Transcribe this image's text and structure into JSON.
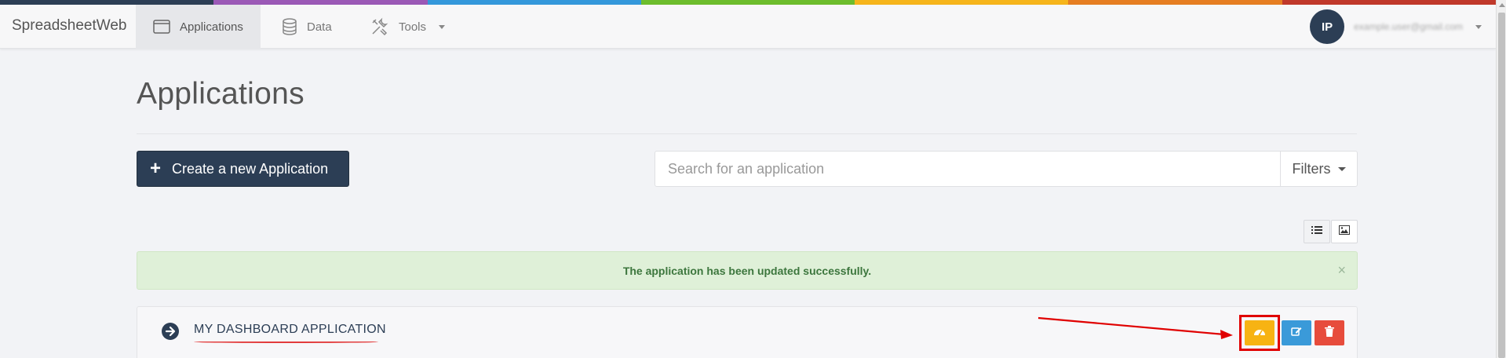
{
  "colors": {
    "strip": [
      "#2c3e55",
      "#9b59b6",
      "#3498db",
      "#6dbd2d",
      "#f6b51b",
      "#e67e22",
      "#c0392b"
    ],
    "primary": "#2c3e55",
    "dashboard_button": "#f7b313",
    "edit_button": "#3a9ad9",
    "delete_button": "#e74c3c",
    "alert_bg": "#dff0d8",
    "annotation": "#e00000"
  },
  "navbar": {
    "brand": "SpreadsheetWeb",
    "items": [
      {
        "label": "Applications",
        "icon": "window-icon",
        "active": true
      },
      {
        "label": "Data",
        "icon": "database-icon",
        "active": false
      },
      {
        "label": "Tools",
        "icon": "tools-icon",
        "active": false,
        "dropdown": true
      }
    ],
    "user": {
      "initials": "IP",
      "email": "example.user@gmail.com"
    }
  },
  "page": {
    "title": "Applications",
    "create_button": "Create a new Application",
    "search": {
      "placeholder": "Search for an application",
      "value": ""
    },
    "filters_label": "Filters",
    "view_modes": [
      {
        "name": "list",
        "icon": "list-icon",
        "active": true
      },
      {
        "name": "grid",
        "icon": "image-icon",
        "active": false
      }
    ],
    "alert": {
      "message": "The application has been updated successfully.",
      "close": "×"
    },
    "applications": [
      {
        "name": "MY DASHBOARD APPLICATION",
        "actions": [
          "dashboard-icon",
          "edit-icon",
          "trash-icon"
        ]
      }
    ]
  }
}
